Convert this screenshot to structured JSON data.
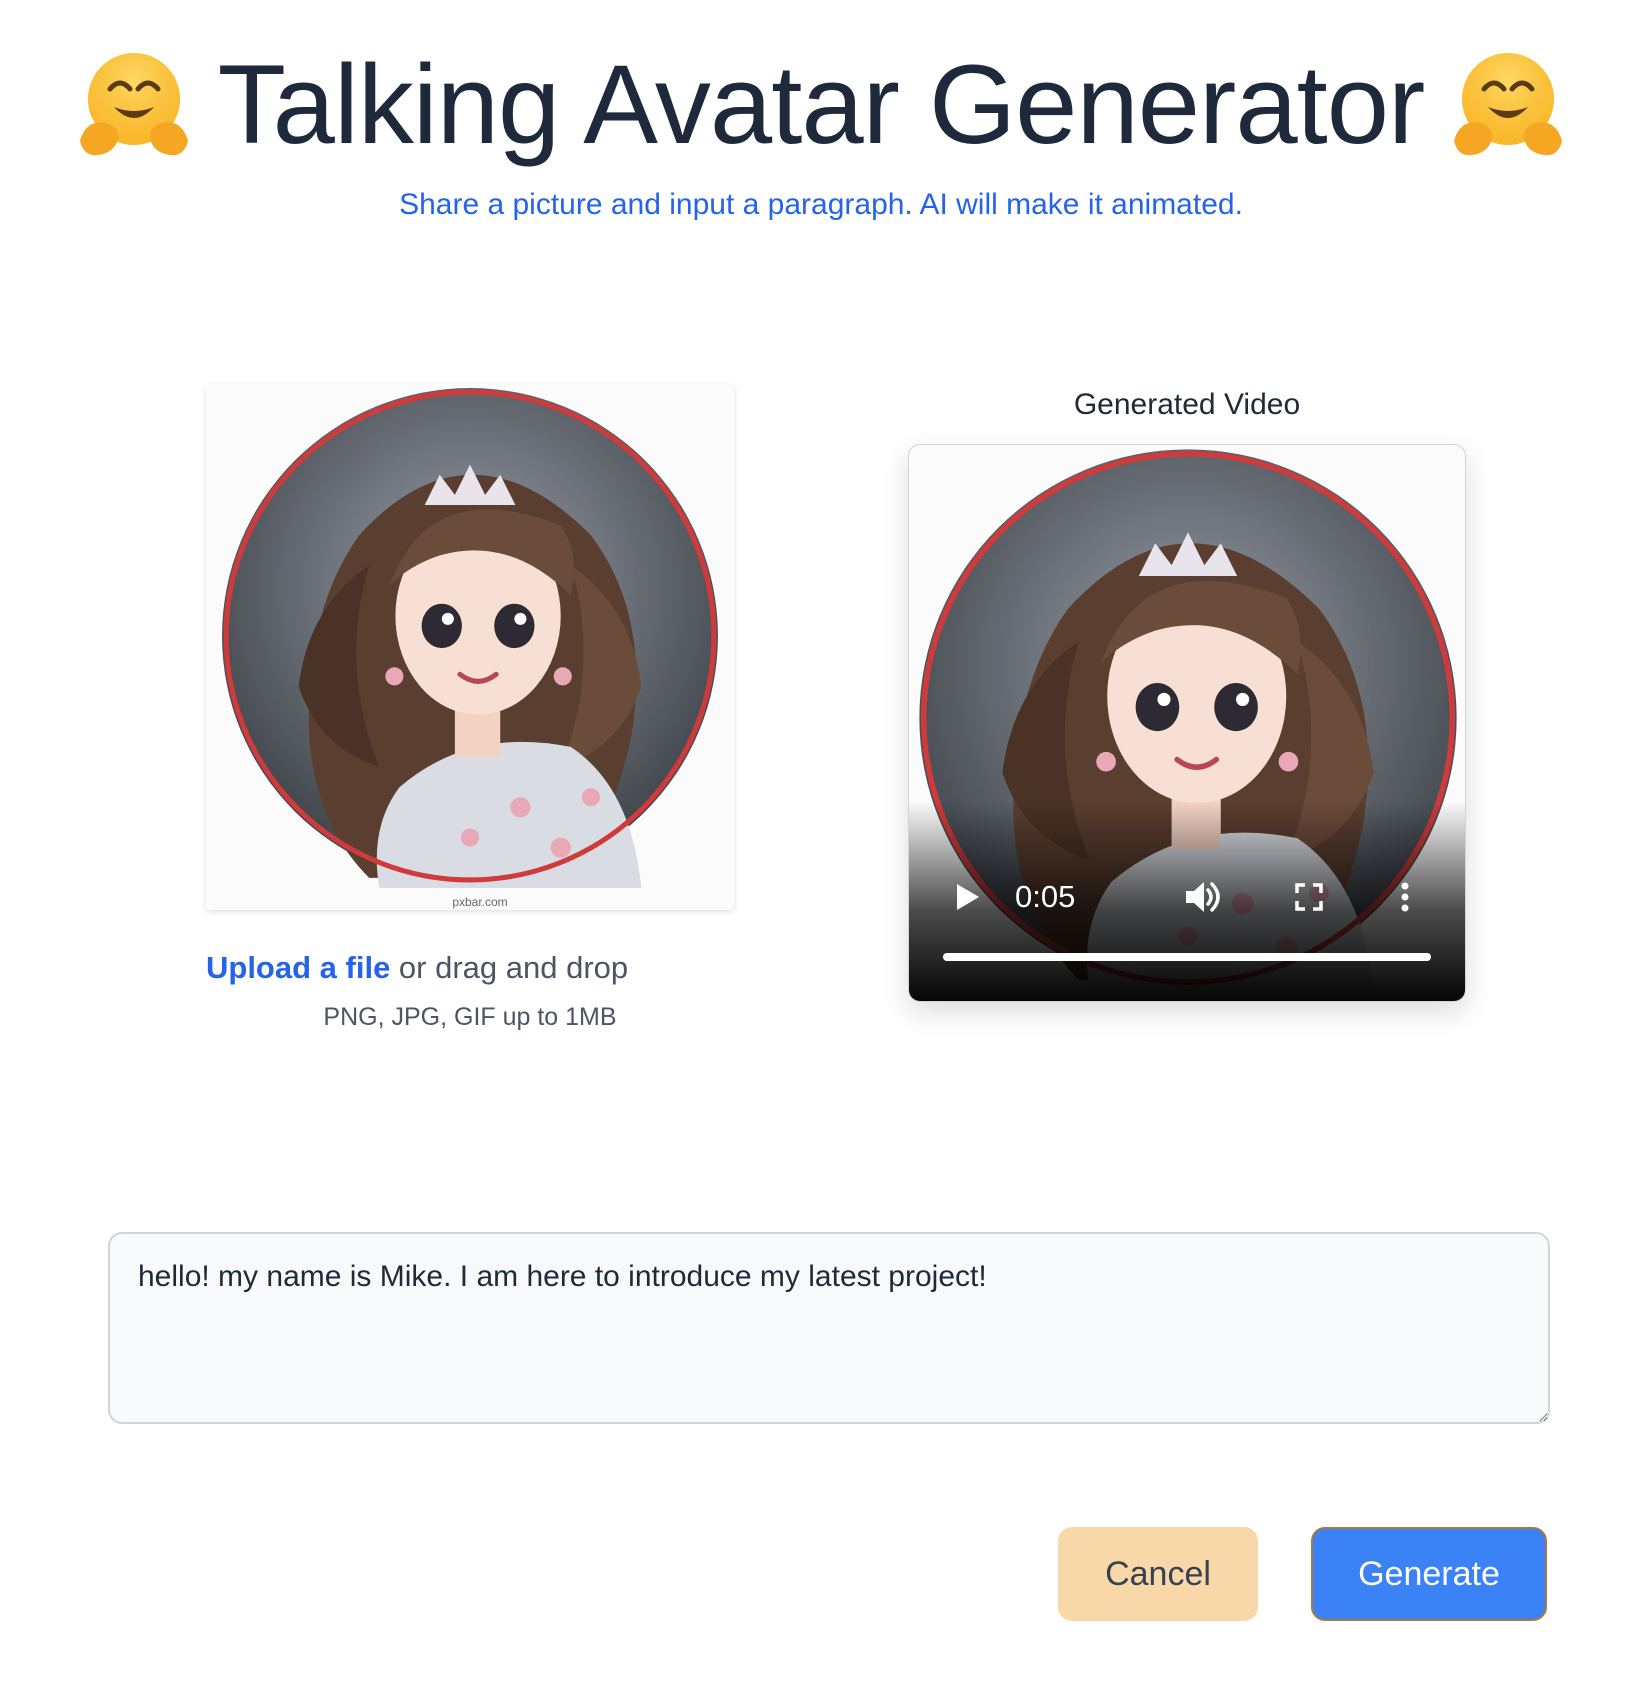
{
  "header": {
    "emoji_icon": "hugging-face-icon",
    "title": "Talking Avatar Generator",
    "subtitle": "Share a picture and input a paragraph. AI will make it animated."
  },
  "upload": {
    "link_text": "Upload a file",
    "rest_text": " or drag and drop",
    "hint": "PNG, JPG, GIF up to 1MB",
    "image_caption": "pxbar.com"
  },
  "video": {
    "label": "Generated Video",
    "time": "0:05",
    "progress": 1.0,
    "icons": [
      "play-icon",
      "volume-icon",
      "fullscreen-icon",
      "more-options-icon"
    ]
  },
  "input": {
    "value": "hello! my name is Mike. I am here to introduce my latest project!"
  },
  "buttons": {
    "cancel": "Cancel",
    "generate": "Generate"
  },
  "colors": {
    "accent": "#2563eb",
    "generate_bg": "#3b82f6",
    "cancel_bg": "#f8d8a9",
    "avatar_ring": "#d03a3a"
  }
}
